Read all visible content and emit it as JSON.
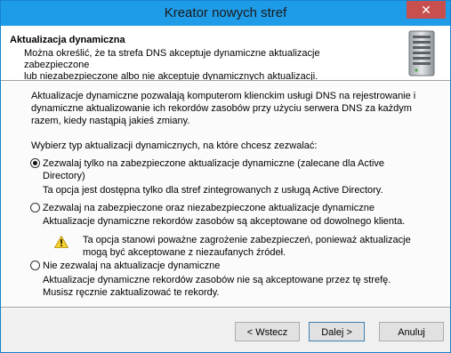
{
  "window": {
    "title": "Kreator nowych stref",
    "close_glyph": "✕"
  },
  "header": {
    "title": "Aktualizacja dynamiczna",
    "description_1": "Można określić, że ta strefa DNS akceptuje dynamiczne aktualizacje zabezpieczone",
    "description_2": "lub niezabezpieczone albo nie akceptuje dynamicznych aktualizacji.",
    "icon": "server-icon"
  },
  "body": {
    "intro_1": "Aktualizacje dynamiczne pozwalają komputerom klienckim usługi DNS na rejestrowanie i",
    "intro_2": "dynamiczne aktualizowanie ich rekordów zasobów przy użyciu serwera DNS za każdym",
    "intro_3": "razem, kiedy nastąpią jakieś zmiany.",
    "prompt": "Wybierz typ aktualizacji dynamicznych, na które chcesz zezwalać:",
    "options": [
      {
        "label_1": "Zezwalaj tylko na zabezpieczone aktualizacje dynamiczne (zalecane dla Active",
        "label_2": "Directory)",
        "desc_1": "Ta opcja jest dostępna tylko dla stref zintegrowanych z usługą Active Directory.",
        "selected": true
      },
      {
        "label_1": "Zezwalaj na zabezpieczone oraz niezabezpieczone aktualizacje dynamiczne",
        "desc_1": "Aktualizacje dynamiczne rekordów zasobów są akceptowane od dowolnego klienta.",
        "warning_1": "Ta opcja stanowi poważne zagrożenie zabezpieczeń, ponieważ aktualizacje",
        "warning_2": "mogą być akceptowane z niezaufanych źródeł.",
        "warning_icon": "warning-icon",
        "selected": false
      },
      {
        "label_1": "Nie zezwalaj na aktualizacje dynamiczne",
        "desc_1": "Aktualizacje dynamiczne rekordów zasobów nie są akceptowane przez tę strefę.",
        "desc_2": "Musisz ręcznie zaktualizować te rekordy.",
        "selected": false
      }
    ]
  },
  "footer": {
    "back_label": "< Wstecz",
    "next_label": "Dalej >",
    "cancel_label": "Anuluj"
  }
}
